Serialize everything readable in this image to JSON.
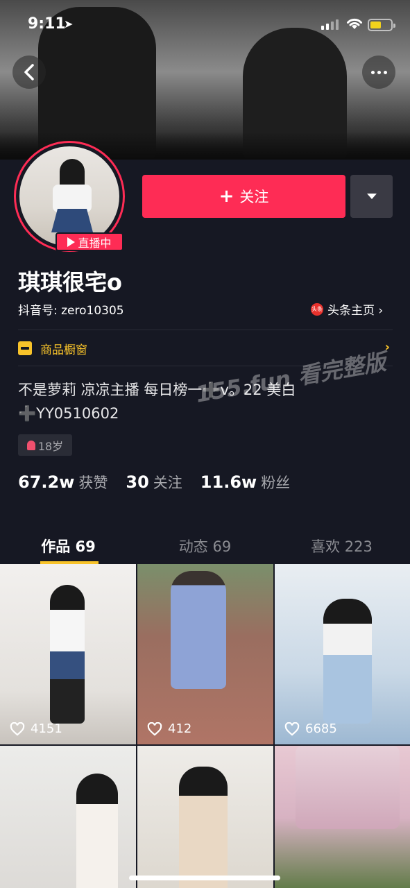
{
  "status_bar": {
    "time": "9:11",
    "location_icon": "location-arrow-icon"
  },
  "cover": {
    "back_icon": "chevron-left-icon",
    "more_icon": "more-dots-icon"
  },
  "profile": {
    "live_badge": "直播中",
    "follow_label": "关注",
    "name": "琪琪很宅o",
    "douyin_id": "抖音号: zero10305",
    "toutiao_logo": "头条",
    "toutiao_link": "头条主页 ›",
    "shop_label": "商品橱窗",
    "bio_line1": "不是萝莉 凉凉主播  每日榜一➕v。22 美白",
    "bio_line2": "➕YY0510602",
    "age_tag": "18岁",
    "watermark": "155.fun 看完整版"
  },
  "stats": [
    {
      "num": "67.2w",
      "label": "获赞"
    },
    {
      "num": "30",
      "label": "关注"
    },
    {
      "num": "11.6w",
      "label": "粉丝"
    }
  ],
  "tabs": [
    {
      "label": "作品 69",
      "active": true
    },
    {
      "label": "动态 69",
      "active": false
    },
    {
      "label": "喜欢 223",
      "active": false
    }
  ],
  "videos": [
    {
      "likes": "4151"
    },
    {
      "likes": "412"
    },
    {
      "likes": "6685"
    },
    {
      "likes": ""
    },
    {
      "likes": ""
    },
    {
      "likes": ""
    }
  ],
  "colors": {
    "accent": "#fe2c55",
    "shop": "#f8c32a",
    "background": "#161823"
  }
}
